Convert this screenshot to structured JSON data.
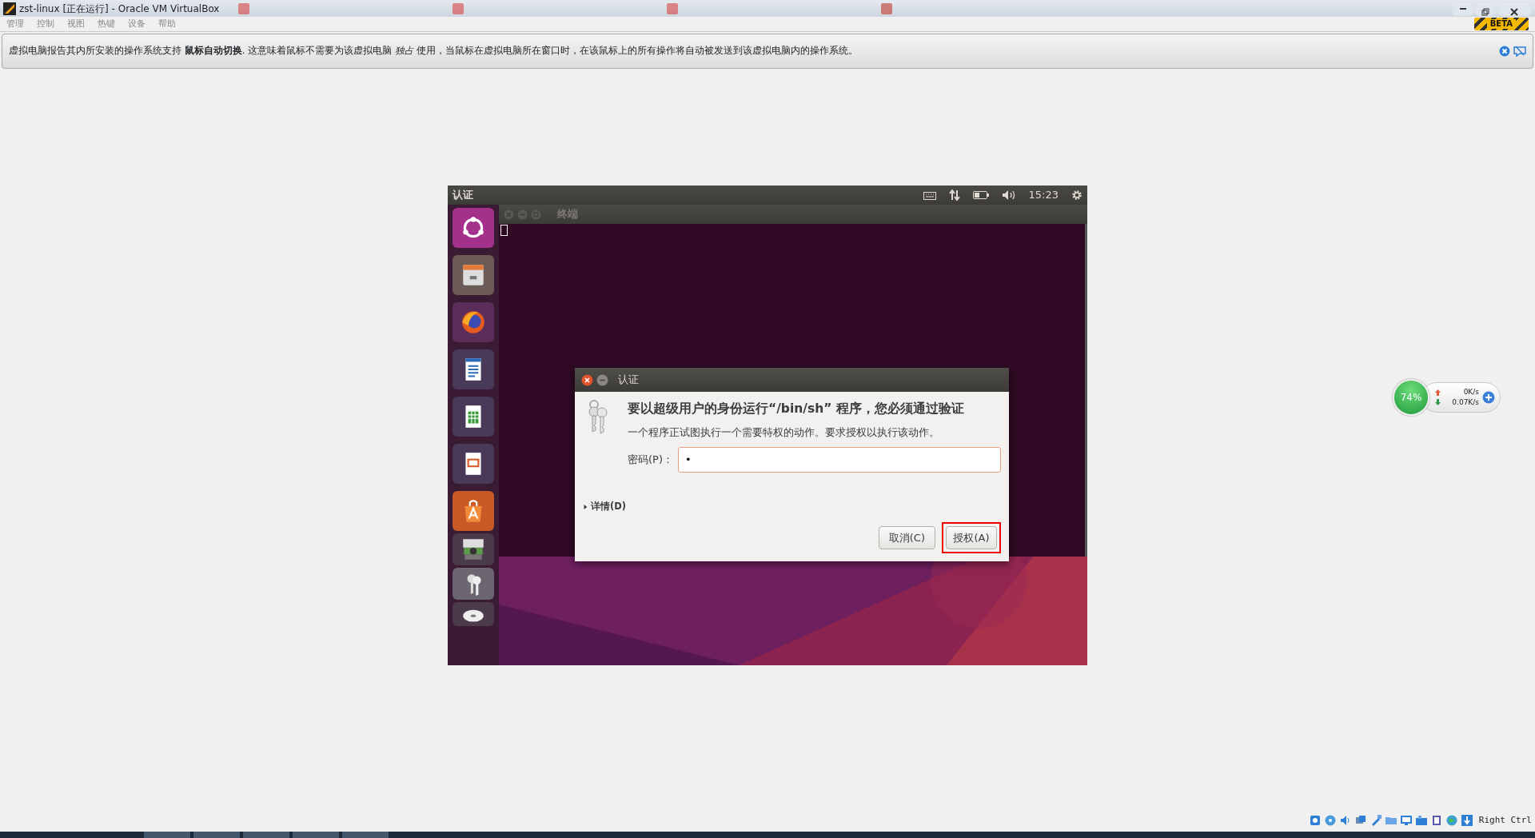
{
  "window": {
    "title": "zst-linux [正在运行] - Oracle VM VirtualBox"
  },
  "menu": [
    "管理",
    "控制",
    "视图",
    "热键",
    "设备",
    "帮助"
  ],
  "beta_badge": "BETA",
  "notification": {
    "text": "虚拟电脑报告其内所安装的操作系统支持 **鼠标自动切换**. 这意味着鼠标不需要为该虚拟电脑 *独占* 使用，当鼠标在虚拟电脑所在窗口时，在该鼠标上的所有操作将自动被发送到该虚拟电脑内的操作系统。"
  },
  "guest": {
    "top_bar": {
      "title": "认证",
      "clock": "15:23"
    },
    "terminal": {
      "title": "终端"
    },
    "dialog": {
      "title": "认证",
      "heading": "要以超级用户的身份运行“/bin/sh” 程序，您必须通过验证",
      "message": "一个程序正试图执行一个需要特权的动作。要求授权以执行该动作。",
      "password_label": "密码(P)：",
      "password_value": "•",
      "details": {
        "label": "详情(D)",
        "expanded": false
      },
      "buttons": [
        {
          "label": "取消(C)",
          "kind": "cancel"
        },
        {
          "label": "授权(A)",
          "kind": "default"
        }
      ]
    }
  },
  "network_widget": {
    "percent": "74%",
    "upload": "0K/s",
    "download": "0.07K/s"
  },
  "status_bar": {
    "host_key": "Right Ctrl"
  }
}
